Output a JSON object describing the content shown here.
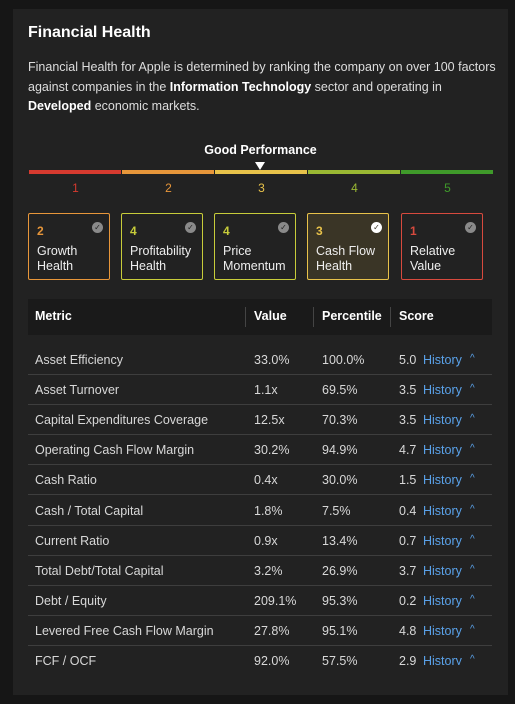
{
  "header": {
    "title": "Financial Health",
    "desc_part1": "Financial Health for Apple is determined by ranking the company on over 100 factors against companies in the ",
    "desc_bold1": "Information Technology",
    "desc_part2": " sector and operating in ",
    "desc_bold2": "Developed",
    "desc_part3": " economic markets."
  },
  "performance": {
    "label": "Good Performance",
    "current_level": 3,
    "levels": [
      {
        "num": "1",
        "color": "#d63a2f"
      },
      {
        "num": "2",
        "color": "#e7963a"
      },
      {
        "num": "3",
        "color": "#e8c24a"
      },
      {
        "num": "4",
        "color": "#9ab833"
      },
      {
        "num": "5",
        "color": "#3f9a2a"
      }
    ]
  },
  "cards": [
    {
      "num": "2",
      "label": "Growth Health",
      "color": "#e7963a",
      "checked": false
    },
    {
      "num": "4",
      "label": "Profitability Health",
      "color": "#c7cc3a",
      "checked": false
    },
    {
      "num": "4",
      "label": "Price Momentum",
      "color": "#c7cc3a",
      "checked": false
    },
    {
      "num": "3",
      "label": "Cash Flow Health",
      "color": "#e8c24a",
      "checked": true
    },
    {
      "num": "1",
      "label": "Relative Value",
      "color": "#d84a3e",
      "checked": false
    }
  ],
  "table": {
    "headers": [
      "Metric",
      "Value",
      "Percentile",
      "Score"
    ],
    "history_label": "History",
    "rows": [
      {
        "metric": "Asset Efficiency",
        "value": "33.0%",
        "percentile": "100.0%",
        "score": "5.0"
      },
      {
        "metric": "Asset Turnover",
        "value": "1.1x",
        "percentile": "69.5%",
        "score": "3.5"
      },
      {
        "metric": "Capital Expenditures Coverage",
        "value": "12.5x",
        "percentile": "70.3%",
        "score": "3.5"
      },
      {
        "metric": "Operating Cash Flow Margin",
        "value": "30.2%",
        "percentile": "94.9%",
        "score": "4.7"
      },
      {
        "metric": "Cash Ratio",
        "value": "0.4x",
        "percentile": "30.0%",
        "score": "1.5"
      },
      {
        "metric": "Cash / Total Capital",
        "value": "1.8%",
        "percentile": "7.5%",
        "score": "0.4"
      },
      {
        "metric": "Current Ratio",
        "value": "0.9x",
        "percentile": "13.4%",
        "score": "0.7"
      },
      {
        "metric": "Total Debt/Total Capital",
        "value": "3.2%",
        "percentile": "26.9%",
        "score": "3.7"
      },
      {
        "metric": "Debt / Equity",
        "value": "209.1%",
        "percentile": "95.3%",
        "score": "0.2"
      },
      {
        "metric": "Levered Free Cash Flow Margin",
        "value": "27.8%",
        "percentile": "95.1%",
        "score": "4.8"
      },
      {
        "metric": "FCF / OCF",
        "value": "92.0%",
        "percentile": "57.5%",
        "score": "2.9"
      }
    ]
  }
}
